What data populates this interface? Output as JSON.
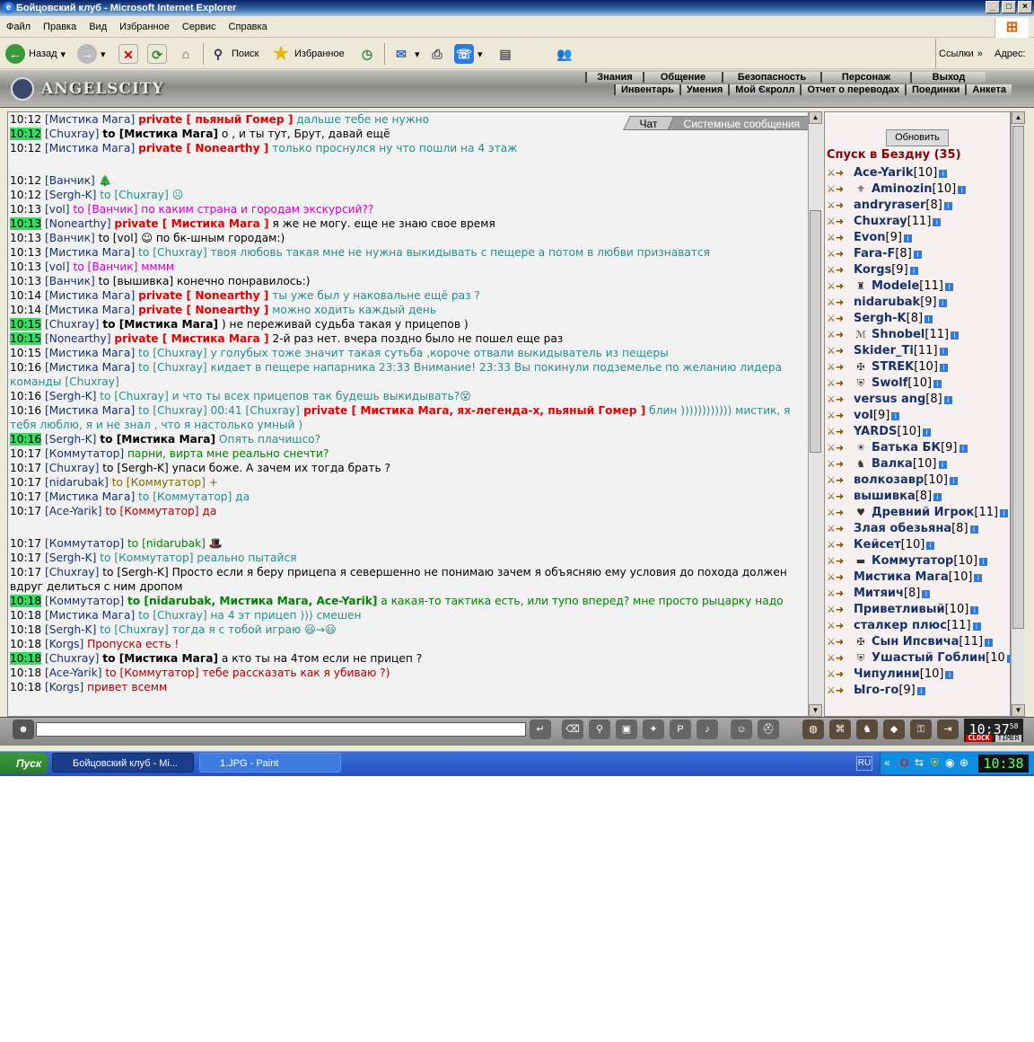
{
  "window": {
    "title": "Бойцовский клуб - Microsoft Internet Explorer"
  },
  "menu": [
    "Файл",
    "Правка",
    "Вид",
    "Избранное",
    "Сервис",
    "Справка"
  ],
  "toolbar": {
    "back": "Назад",
    "search": "Поиск",
    "favorites": "Избранное",
    "links": "Ссылки",
    "address": "Адрес:"
  },
  "game": {
    "logo": "ANGELSCITY",
    "nav_top": [
      "Знания",
      "Общение",
      "Безопасность",
      "Персонаж",
      "Выход"
    ],
    "nav_bottom": [
      "Инвентарь",
      "Умения",
      "Мой Єкролл",
      "Отчет о переводах",
      "Поединки",
      "Анкета"
    ]
  },
  "chat": {
    "tabs": [
      "Чат",
      "Системные сообщения"
    ],
    "lines": [
      {
        "time": "10:12",
        "hl": false,
        "nick": "[Мистика Мага]",
        "mid": "private [ пьяный Гомер ]",
        "midcls": "pv",
        "text": " дальше тебе не нужно",
        "cls": "c1"
      },
      {
        "time": "10:12",
        "hl": true,
        "nick": "[Chuxray]",
        "mid": "to [Мистика Мага]",
        "midcls": "nkb",
        "text": " о , и ты тут, Брут, давай ещё",
        "cls": "c6"
      },
      {
        "time": "10:12",
        "hl": false,
        "nick": "[Мистика Мага]",
        "mid": "private [ Nonearthy ]",
        "midcls": "pv",
        "text": " только проснулся ну что пошли на 4 этаж",
        "cls": "c1"
      },
      {
        "time": "",
        "hl": false,
        "nick": "",
        "mid": "",
        "midcls": "",
        "text": "",
        "cls": "c6",
        "spacer": true
      },
      {
        "time": "10:12",
        "hl": false,
        "nick": "[Ванчик]",
        "mid": "",
        "midcls": "",
        "text": " 🎄",
        "cls": "c6"
      },
      {
        "time": "10:12",
        "hl": false,
        "nick": "[Sergh-K]",
        "mid": "to [Chuxray]",
        "midcls": "c1",
        "text": " ☹",
        "cls": "c1"
      },
      {
        "time": "10:13",
        "hl": false,
        "nick": "[vol]",
        "mid": "to [Ванчик]",
        "midcls": "c3",
        "text": " по каким страна и городам экскурсий??",
        "cls": "c3"
      },
      {
        "time": "10:13",
        "hl": true,
        "nick": "[Nonearthy]",
        "mid": "private [ Мистика Мага ]",
        "midcls": "pv",
        "text": " я же не могу. еще не знаю свое время",
        "cls": "c6"
      },
      {
        "time": "10:13",
        "hl": false,
        "nick": "[Ванчик]",
        "mid": "to [vol]",
        "midcls": "c6",
        "text": " ☺ по бк-шным городам:)",
        "cls": "c6"
      },
      {
        "time": "10:13",
        "hl": false,
        "nick": "[Мистика Мага]",
        "mid": "to [Chuxray]",
        "midcls": "c1",
        "text": " твоя любовь такая мне не нужна выкидывать с пещере а потом в любви признаватся",
        "cls": "c1"
      },
      {
        "time": "10:13",
        "hl": false,
        "nick": "[vol]",
        "mid": "to [Ванчик]",
        "midcls": "c3",
        "text": " мммм",
        "cls": "c3"
      },
      {
        "time": "10:13",
        "hl": false,
        "nick": "[Ванчик]",
        "mid": "to [вышивка]",
        "midcls": "c6",
        "text": " конечно понравилось:)",
        "cls": "c6"
      },
      {
        "time": "10:14",
        "hl": false,
        "nick": "[Мистика Мага]",
        "mid": "private [ Nonearthy ]",
        "midcls": "pv",
        "text": " ты уже был у наковальне ещё раз ?",
        "cls": "c1"
      },
      {
        "time": "10:14",
        "hl": false,
        "nick": "[Мистика Мага]",
        "mid": "private [ Nonearthy ]",
        "midcls": "pv",
        "text": " можно ходить каждый день",
        "cls": "c1"
      },
      {
        "time": "10:15",
        "hl": true,
        "nick": "[Chuxray]",
        "mid": "to [Мистика Мага]",
        "midcls": "nkb",
        "text": " ) не переживай судьба такая у прицепов )",
        "cls": "c6"
      },
      {
        "time": "10:15",
        "hl": true,
        "nick": "[Nonearthy]",
        "mid": "private [ Мистика Мага ]",
        "midcls": "pv",
        "text": " 2-й раз нет. вчера поздно было не пошел еще раз",
        "cls": "c6"
      },
      {
        "time": "10:15",
        "hl": false,
        "nick": "[Мистика Мага]",
        "mid": "to [Chuxray]",
        "midcls": "c1",
        "text": " у голубых тоже значит такая сутьба ,короче отвали выкидыватель из пещеры",
        "cls": "c1"
      },
      {
        "time": "10:16",
        "hl": false,
        "nick": "[Мистика Мага]",
        "mid": "to [Chuxray]",
        "midcls": "c1",
        "text": " кидает в пещере напарника 23:33 Внимание! 23:33 Вы покинули подземелье по желанию лидера команды [Chuxray]",
        "cls": "c1"
      },
      {
        "time": "10:16",
        "hl": false,
        "nick": "[Sergh-K]",
        "mid": "to [Chuxray]",
        "midcls": "c1",
        "text": " и что ты всех прицепов так будешь выкидывать?😵",
        "cls": "c1"
      },
      {
        "time": "10:16",
        "hl": false,
        "nick": "[Мистика Мага]",
        "mid": "to [Chuxray] 00:41 [Chuxray]",
        "midcls": "c1",
        "text": "",
        "cls": "c1",
        "private2": " private [ Мистика Мага, ях-легенда-х, пьяный Гомер ]",
        "tail": " блин )))))))))))) мистик, я тебя люблю, я и не знал , что я настолько умный )"
      },
      {
        "time": "10:16",
        "hl": true,
        "nick": "[Sergh-K]",
        "mid": "to [Мистика Мага]",
        "midcls": "nkb",
        "text": " Опять плачишсо?",
        "cls": "c1"
      },
      {
        "time": "10:17",
        "hl": false,
        "nick": "[Коммутатор]",
        "mid": "",
        "midcls": "",
        "text": " парни, вирта мне реально снечти?",
        "cls": "c5"
      },
      {
        "time": "10:17",
        "hl": false,
        "nick": "[Chuxray]",
        "mid": "to [Sergh-K]",
        "midcls": "c6",
        "text": " упаси боже. А зачем их тогда брать ?",
        "cls": "c6"
      },
      {
        "time": "10:17",
        "hl": false,
        "nick": "[nidarubak]",
        "mid": "to [Коммутатор]",
        "midcls": "c2",
        "text": " +",
        "cls": "c2"
      },
      {
        "time": "10:17",
        "hl": false,
        "nick": "[Мистика Мага]",
        "mid": "to [Коммутатор]",
        "midcls": "c1",
        "text": " да",
        "cls": "c1"
      },
      {
        "time": "10:17",
        "hl": false,
        "nick": "[Ace-Yarik]",
        "mid": "to [Коммутатор]",
        "midcls": "c4",
        "text": " да",
        "cls": "c4"
      },
      {
        "time": "",
        "hl": false,
        "nick": "",
        "mid": "",
        "midcls": "",
        "text": "",
        "cls": "c6",
        "spacer": true
      },
      {
        "time": "10:17",
        "hl": false,
        "nick": "[Коммутатор]",
        "mid": "to [nidarubak]",
        "midcls": "c5",
        "text": " 🎩",
        "cls": "c5"
      },
      {
        "time": "10:17",
        "hl": false,
        "nick": "[Sergh-K]",
        "mid": "to [Коммутатор]",
        "midcls": "c1",
        "text": " реально пытайся",
        "cls": "c1"
      },
      {
        "time": "10:17",
        "hl": false,
        "nick": "[Chuxray]",
        "mid": "to [Sergh-K]",
        "midcls": "c6",
        "text": " Просто если я беру прицепа я севершенно не понимаю зачем я объясняю ему условия до похода должен вдруг делиться с ним дропом",
        "cls": "c6"
      },
      {
        "time": "10:18",
        "hl": true,
        "nick": "[Коммутатор]",
        "mid": "to [nidarubak, Мистика Мага, Ace-Yarik]",
        "midcls": "c5b",
        "text": " а какая-то тактика есть, или тупо вперед? мне просто рыцарку надо",
        "cls": "c5"
      },
      {
        "time": "10:18",
        "hl": false,
        "nick": "[Мистика Мага]",
        "mid": "to [Chuxray]",
        "midcls": "c1",
        "text": " на 4 эт прицеп ))) смешен",
        "cls": "c1"
      },
      {
        "time": "10:18",
        "hl": false,
        "nick": "[Sergh-K]",
        "mid": "to [Chuxray]",
        "midcls": "c1",
        "text": " тогда я с тобой играю 😃→😃",
        "cls": "c1"
      },
      {
        "time": "10:18",
        "hl": false,
        "nick": "[Korgs]",
        "mid": "",
        "midcls": "",
        "text": " Пропуска есть !",
        "cls": "c4"
      },
      {
        "time": "10:18",
        "hl": true,
        "nick": "[Chuxray]",
        "mid": "to [Мистика Мага]",
        "midcls": "nkb",
        "text": " а кто ты на 4том если не прицеп ?",
        "cls": "c6"
      },
      {
        "time": "10:18",
        "hl": false,
        "nick": "[Ace-Yarik]",
        "mid": "to [Коммутатор]",
        "midcls": "c4",
        "text": " тебе рассказать как я убиваю ?)",
        "cls": "c4"
      },
      {
        "time": "10:18",
        "hl": false,
        "nick": "[Korgs]",
        "mid": "",
        "midcls": "",
        "text": " привет всемм",
        "cls": "c4"
      }
    ]
  },
  "room": {
    "refresh": "Обновить",
    "title": "Спуск в Бездну (35)",
    "users": [
      {
        "name": "Ace-Yarik",
        "level": "[10]",
        "clan": ""
      },
      {
        "name": "Aminozin",
        "level": "[10]",
        "clan": "⚜"
      },
      {
        "name": "andryraser",
        "level": "[8]",
        "clan": ""
      },
      {
        "name": "Chuxray",
        "level": "[11]",
        "clan": ""
      },
      {
        "name": "Evon",
        "level": "[9]",
        "clan": ""
      },
      {
        "name": "Fara-F",
        "level": "[8]",
        "clan": ""
      },
      {
        "name": "Korgs",
        "level": "[9]",
        "clan": ""
      },
      {
        "name": "Modele",
        "level": "[11]",
        "clan": "♜"
      },
      {
        "name": "nidarubak",
        "level": "[9]",
        "clan": ""
      },
      {
        "name": "Sergh-K",
        "level": "[8]",
        "clan": ""
      },
      {
        "name": "Shnobel",
        "level": "[11]",
        "clan": "ℳ"
      },
      {
        "name": "Skider_Ti",
        "level": "[11]",
        "clan": ""
      },
      {
        "name": "STREK",
        "level": "[10]",
        "clan": "✠"
      },
      {
        "name": "Swolf",
        "level": "[10]",
        "clan": "⛨"
      },
      {
        "name": "versus ang",
        "level": "[8]",
        "clan": ""
      },
      {
        "name": "vol",
        "level": "[9]",
        "clan": ""
      },
      {
        "name": "YARDS",
        "level": "[10]",
        "clan": ""
      },
      {
        "name": "Батька БК",
        "level": "[9]",
        "clan": "☀"
      },
      {
        "name": "Валка",
        "level": "[10]",
        "clan": "♞"
      },
      {
        "name": "волкозавр",
        "level": "[10]",
        "clan": ""
      },
      {
        "name": "вышивка",
        "level": "[8]",
        "clan": ""
      },
      {
        "name": "Древний Игрок",
        "level": "[11]",
        "clan": "♥"
      },
      {
        "name": "Злая обезьяна",
        "level": "[8]",
        "clan": ""
      },
      {
        "name": "Кейсет",
        "level": "[10]",
        "clan": ""
      },
      {
        "name": "Коммутатор",
        "level": "[10]",
        "clan": "▬"
      },
      {
        "name": "Мистика Мага",
        "level": "[10]",
        "clan": ""
      },
      {
        "name": "Митяич",
        "level": "[8]",
        "clan": ""
      },
      {
        "name": "Приветливый",
        "level": "[10]",
        "clan": ""
      },
      {
        "name": "сталкер плюс",
        "level": "[11]",
        "clan": ""
      },
      {
        "name": "Сын Ипсвича",
        "level": "[11]",
        "clan": "✠"
      },
      {
        "name": "Ушастый Гоблин",
        "level": "[10",
        "clan": "⛨"
      },
      {
        "name": "Чипулини",
        "level": "[10]",
        "clan": ""
      },
      {
        "name": "Ыго-го",
        "level": "[9]",
        "clan": ""
      }
    ]
  },
  "bottom": {
    "clock": "10:37",
    "seconds": "58",
    "clock_label": "CLOCK",
    "timer_label": "TIMER"
  },
  "taskbar": {
    "start": "Пуск",
    "task1": "Бойцовский клуб - Mi...",
    "task2": "1.JPG - Paint",
    "lang": "RU",
    "time": "10:38"
  }
}
